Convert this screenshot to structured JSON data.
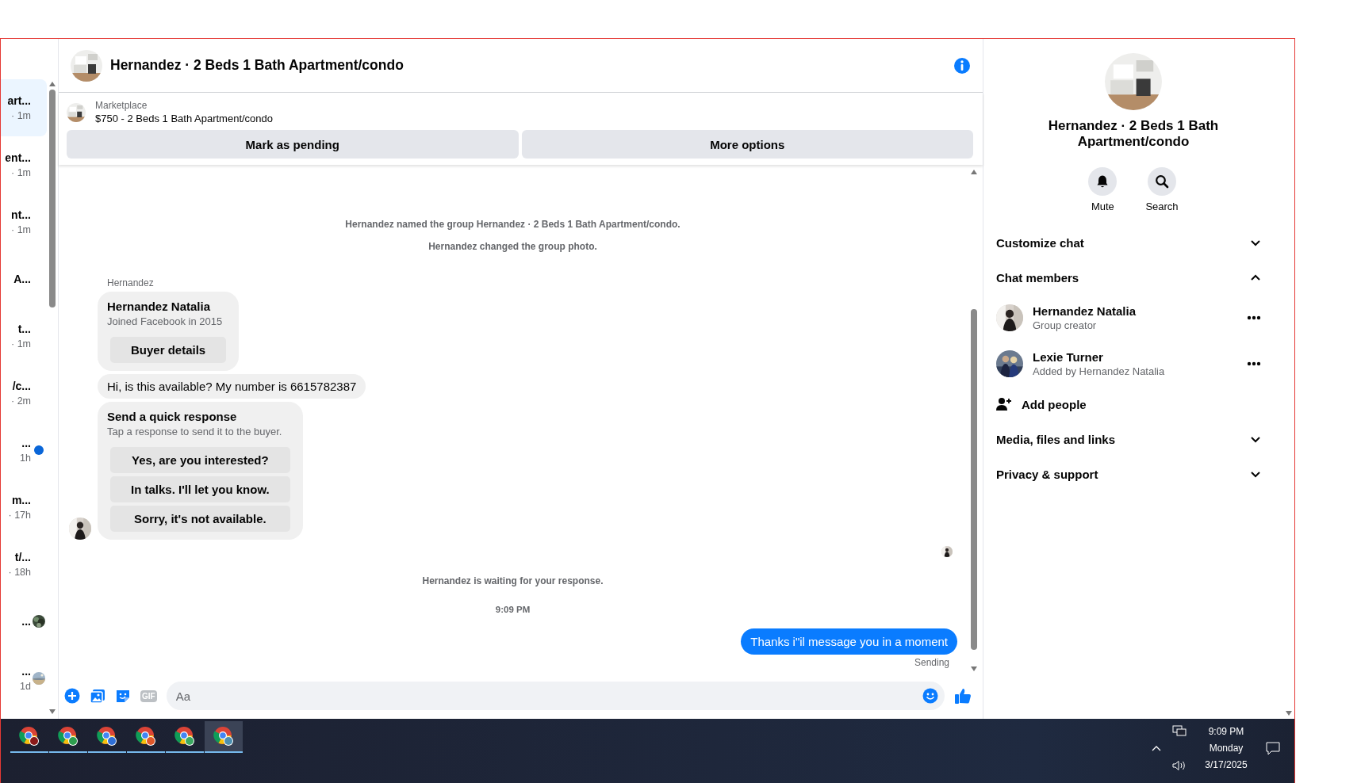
{
  "conversations": [
    {
      "title": "art...",
      "time": "· 1m",
      "selected": true,
      "kind": "plain"
    },
    {
      "title": "ent...",
      "time": "· 1m",
      "selected": false,
      "kind": "plain"
    },
    {
      "title": "nt...",
      "time": "· 1m",
      "selected": false,
      "kind": "plain"
    },
    {
      "title": "A...",
      "selected": false,
      "kind": "plain"
    },
    {
      "title": "t...",
      "time": "· 1m",
      "selected": false,
      "kind": "plain"
    },
    {
      "title": "/c...",
      "time": "· 2m",
      "selected": false,
      "kind": "plain"
    },
    {
      "title": "...",
      "time": "1h",
      "selected": false,
      "kind": "unread"
    },
    {
      "title": "m...",
      "time": "· 17h",
      "selected": false,
      "kind": "plain"
    },
    {
      "title": "t/...",
      "time": "· 18h",
      "selected": false,
      "kind": "plain"
    },
    {
      "title": "...",
      "selected": false,
      "kind": "seen"
    },
    {
      "title": "...",
      "time": "1d",
      "selected": false,
      "kind": "seen"
    }
  ],
  "chat": {
    "title": "Hernandez · 2 Beds 1 Bath Apartment/condo",
    "listing": {
      "label": "Marketplace",
      "text": "$750 - 2 Beds 1 Bath Apartment/condo"
    },
    "actions": [
      "Mark as pending",
      "More options"
    ],
    "messages": [
      {
        "kind": "system",
        "text": "Hernandez named the group Hernandez · 2 Beds 1 Bath Apartment/condo."
      },
      {
        "kind": "system",
        "text": "Hernandez changed the group photo."
      },
      {
        "kind": "group",
        "sender": "Hernandez",
        "items": [
          {
            "kind": "profile",
            "name": "Hernandez Natalia",
            "subtitle": "Joined Facebook in 2015",
            "button": "Buyer details"
          },
          {
            "kind": "incoming",
            "text": "Hi, is this available? My number is 6615782387"
          },
          {
            "kind": "quick",
            "title": "Send a quick response",
            "subtitle": "Tap a response to send it to the buyer.",
            "options": [
              "Yes, are you interested?",
              "In talks. I'll let you know.",
              "Sorry, it's not available."
            ]
          }
        ]
      },
      {
        "kind": "seen"
      },
      {
        "kind": "system",
        "text": "Hernandez is waiting for your response."
      },
      {
        "kind": "time",
        "text": "9:09 PM"
      },
      {
        "kind": "outgoing",
        "text": "Thanks i\"il message you in a moment",
        "status": "Sending"
      }
    ],
    "composer": {
      "placeholder": "Aa",
      "gif": "GIF"
    }
  },
  "details": {
    "title": "Hernandez · 2 Beds 1 Bath Apartment/condo",
    "actions": [
      {
        "kind": "mute",
        "label": "Mute"
      },
      {
        "kind": "search",
        "label": "Search"
      }
    ],
    "rows": [
      {
        "kind": "section",
        "label": "Customize chat",
        "expanded": false
      },
      {
        "kind": "section",
        "label": "Chat members",
        "expanded": true
      },
      {
        "kind": "member",
        "name": "Hernandez Natalia",
        "role": "Group creator"
      },
      {
        "kind": "member",
        "name": "Lexie Turner",
        "role": "Added by Hernandez Natalia"
      },
      {
        "kind": "add",
        "label": "Add people"
      },
      {
        "kind": "section",
        "label": "Media, files and links",
        "expanded": false
      },
      {
        "kind": "section",
        "label": "Privacy & support",
        "expanded": false
      }
    ]
  },
  "taskbar": {
    "apps": [
      {
        "selected": false,
        "color": "#8b1a1a"
      },
      {
        "selected": false,
        "color": "#2e9e4f"
      },
      {
        "selected": false,
        "color": "#2f6fd6"
      },
      {
        "selected": false,
        "color": "#e0582a"
      },
      {
        "selected": false,
        "color": "#3aa860"
      },
      {
        "selected": true,
        "color": "#4c8fb0"
      }
    ],
    "time": "9:09 PM",
    "day": "Monday",
    "date": "3/17/2025"
  }
}
